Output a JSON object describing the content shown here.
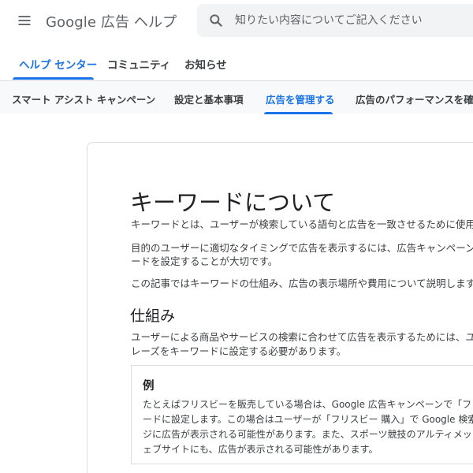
{
  "header": {
    "title": "Google 広告 ヘルプ",
    "search_placeholder": "知りたい内容についてご記入ください",
    "search_value": ""
  },
  "primary_tabs": [
    {
      "label": "ヘルプ センター",
      "active": true
    },
    {
      "label": "コミュニティ",
      "active": false
    },
    {
      "label": "お知らせ",
      "active": false
    }
  ],
  "secondary_nav": [
    {
      "label": "スマート アシスト キャンペーン",
      "active": false
    },
    {
      "label": "設定と基本事項",
      "active": false
    },
    {
      "label": "広告を管理する",
      "active": true
    },
    {
      "label": "広告のパフォーマンスを確認",
      "active": false
    }
  ],
  "article": {
    "title": "キーワードについて",
    "intro_lines": [
      "キーワードとは、ユーザーが検索している語句と広告を一致させるために使用さ",
      "目的のユーザーに適切なタイミングで広告を表示するには、広告キャンペーンで",
      "ードを設定することが大切です。",
      "この記事ではキーワードの仕組み、広告の表示場所や費用について説明します。"
    ],
    "section": {
      "heading": "仕組み",
      "lines": [
        "ユーザーによる商品やサービスの検索に合わせて広告を表示するためには、ユー",
        "レーズをキーワードに設定する必要があります。"
      ]
    },
    "example": {
      "heading": "例",
      "lines": [
        "たとえばフリスビーを販売している場合は、Google 広告キャンペーンで「フリ",
        "ードに設定します。この場合はユーザーが「フリスビー 購入」で Google 検索",
        "ジに広告が表示される可能性があります。また、スポーツ競技のアルティメッ",
        "ェブサイトにも、広告が表示される可能性があります。"
      ]
    }
  },
  "colors": {
    "accent": "#1a73e8",
    "text_primary": "#202124",
    "text_secondary": "#3c4043",
    "search_bg": "#f1f3f4",
    "subnav_bg": "#f8f9fa",
    "border": "#dadce0"
  },
  "icons": {
    "menu": "hamburger-menu-icon",
    "search": "search-icon"
  }
}
